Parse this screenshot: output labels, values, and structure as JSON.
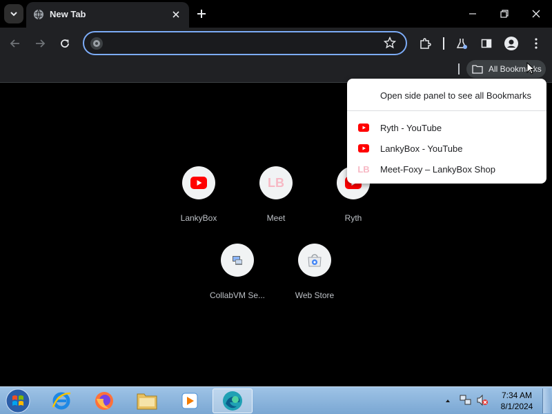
{
  "browser": {
    "tab": {
      "title": "New Tab"
    },
    "omnibox": {
      "value": "",
      "placeholder": ""
    },
    "bookmarks_button": "All Bookmarks"
  },
  "bookmarks_popup": {
    "header": "Open side panel to see all Bookmarks",
    "items": [
      {
        "label": "Ryth - YouTube",
        "icon": "youtube-icon"
      },
      {
        "label": "LankyBox - YouTube",
        "icon": "youtube-icon"
      },
      {
        "label": "Meet-Foxy – LankyBox Shop",
        "icon": "lankybox-logo-icon",
        "icon_text": "LB"
      }
    ]
  },
  "shortcuts": [
    {
      "label": "LankyBox",
      "icon": "youtube-icon"
    },
    {
      "label": "Meet",
      "icon": "lankybox-logo-icon",
      "icon_text": "LB"
    },
    {
      "label": "Ryth",
      "icon": "youtube-icon"
    },
    {
      "label": "CollabVM Se...",
      "icon": "collabvm-icon"
    },
    {
      "label": "Web Store",
      "icon": "web-store-icon"
    }
  ],
  "taskbar": {
    "clock_time": "7:34 AM",
    "clock_date": "8/1/2024",
    "apps": [
      "start-orb",
      "internet-explorer",
      "firefox",
      "file-explorer",
      "media-player",
      "edge-browser"
    ]
  },
  "colors": {
    "accent": "#7cacf8",
    "youtube_red": "#ff0000",
    "lankybox_pink": "#f7b8c4",
    "taskbar_blue": "#8fb5dc"
  }
}
